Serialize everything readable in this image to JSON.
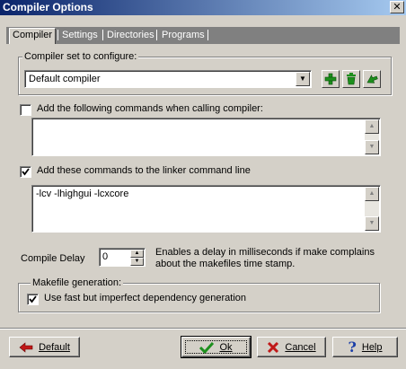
{
  "window": {
    "title": "Compiler Options",
    "close_glyph": "✕"
  },
  "tabs": [
    {
      "label": "Compiler",
      "active": true
    },
    {
      "label": "Settings",
      "active": false
    },
    {
      "label": "Directories",
      "active": false
    },
    {
      "label": "Programs",
      "active": false
    }
  ],
  "compiler_set": {
    "group_label": "Compiler set to configure:",
    "selected": "Default compiler",
    "buttons": [
      {
        "name": "add-compiler-set",
        "icon": "plus-icon",
        "color": "#1d8f1d"
      },
      {
        "name": "delete-compiler-set",
        "icon": "trash-icon",
        "color": "#1d8f1d"
      },
      {
        "name": "rename-compiler-set",
        "icon": "arrow-icon",
        "color": "#1d8f1d"
      }
    ]
  },
  "compiler_commands": {
    "checked": false,
    "label": "Add the following commands when calling compiler:",
    "value": ""
  },
  "linker_commands": {
    "checked": true,
    "label": "Add these commands to the linker command line",
    "value": "-lcv -lhighgui -lcxcore"
  },
  "compile_delay": {
    "label": "Compile Delay",
    "value": "0",
    "description_line1": "Enables a delay in milliseconds if make complains",
    "description_line2": "about the makefiles time stamp."
  },
  "makefile": {
    "group_label": "Makefile generation:",
    "checked": true,
    "option_label": "Use fast but imperfect dependency generation"
  },
  "buttons": {
    "default": "Default",
    "ok": "Ok",
    "cancel": "Cancel",
    "help": "Help"
  },
  "colors": {
    "title_start": "#0a246a",
    "title_end": "#a6caf0",
    "face": "#d4d0c8",
    "accent_red": "#c01818",
    "accent_green": "#1d8f1d",
    "help_blue": "#1c3fa8"
  }
}
